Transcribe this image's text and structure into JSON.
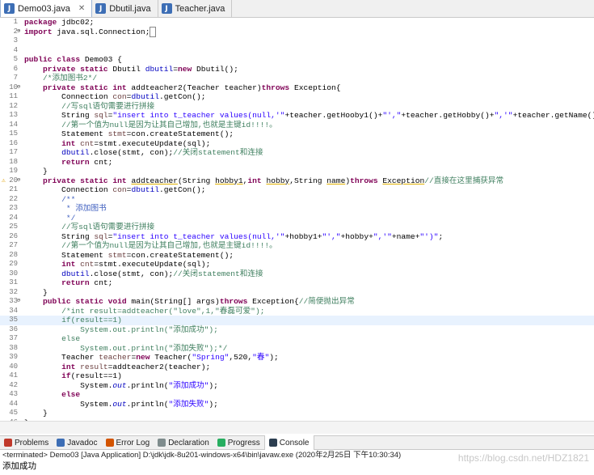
{
  "tabs": [
    {
      "label": "Demo03.java",
      "active": true,
      "icon": "java-file-icon"
    },
    {
      "label": "Dbutil.java",
      "active": false,
      "icon": "java-file-icon"
    },
    {
      "label": "Teacher.java",
      "active": false,
      "icon": "java-file-icon"
    }
  ],
  "editor": {
    "lines": [
      {
        "n": "1",
        "fold": "",
        "marker": "",
        "html": "<span class='kw'>package</span> jdbc02;"
      },
      {
        "n": "2",
        "fold": "⊕",
        "marker": "",
        "html": "<span class='kw'>import</span> java.sql.Connection;<span style='border:1px solid #888'>&nbsp;</span>"
      },
      {
        "n": "3",
        "fold": "",
        "marker": "",
        "html": ""
      },
      {
        "n": "4",
        "fold": "",
        "marker": "",
        "html": ""
      },
      {
        "n": "5",
        "fold": "",
        "marker": "",
        "html": "<span class='kw'>public class</span> Demo03 {"
      },
      {
        "n": "6",
        "fold": "",
        "marker": "",
        "html": "    <span class='kw'>private static</span> Dbutil <span class='fd'>dbutil</span>=<span class='kw'>new</span> Dbutil();"
      },
      {
        "n": "7",
        "fold": "",
        "marker": "",
        "html": "    <span class='cm'>/*添加图书2*/</span>"
      },
      {
        "n": "10",
        "fold": "⊖",
        "marker": "",
        "html": "    <span class='kw'>private static int</span> addteacher2(Teacher teacher)<span class='kw'>throws</span> Exception{"
      },
      {
        "n": "11",
        "fold": "",
        "marker": "",
        "html": "        Connection <span style='color:#6a3e3e'>con</span>=<span class='fd'>dbutil</span>.getCon();"
      },
      {
        "n": "12",
        "fold": "",
        "marker": "",
        "html": "        <span class='cm'>//写sql语句需要进行拼接</span>"
      },
      {
        "n": "13",
        "fold": "",
        "marker": "",
        "html": "        String <span style='color:#6a3e3e'>sql</span>=<span class='st'>\"insert into t_teacher values(null,'\"</span>+teacher.getHooby1()+<span class='st'>\"',\"</span>+teacher.getHobby()+<span class='st'>\",'\"</span>+teacher.getName()+<span class='st'>\"')\"</span>;"
      },
      {
        "n": "14",
        "fold": "",
        "marker": "",
        "html": "        <span class='cm'>//第一个值为null是因为让其自己增加,也就是主键id!!!!。</span>"
      },
      {
        "n": "15",
        "fold": "",
        "marker": "",
        "html": "        Statement <span style='color:#6a3e3e'>stmt</span>=con.createStatement();"
      },
      {
        "n": "16",
        "fold": "",
        "marker": "",
        "html": "        <span class='kw'>int</span> <span style='color:#6a3e3e'>cnt</span>=stmt.executeUpdate(sql);"
      },
      {
        "n": "17",
        "fold": "",
        "marker": "",
        "html": "        <span class='fd'>dbutil</span>.close(stmt, con);<span class='cm'>//关闭statement和连接</span>"
      },
      {
        "n": "18",
        "fold": "",
        "marker": "",
        "html": "        <span class='kw'>return</span> cnt;"
      },
      {
        "n": "19",
        "fold": "",
        "marker": "",
        "html": "    }"
      },
      {
        "n": "20",
        "fold": "⊖",
        "marker": "⚠",
        "html": "    <span class='kw'>private static int</span> <span class='u'>addteacher</span>(String <span class='u'>hobby1</span>,<span class='kw'>int</span> <span class='u'>hobby</span>,String <span class='u'>name</span>)<span class='kw'>throws</span> <span class='u'>Exception</span><span class='cm'>//直接在这里捕获异常</span>"
      },
      {
        "n": "21",
        "fold": "",
        "marker": "",
        "html": "        Connection <span style='color:#6a3e3e'>con</span>=<span class='fd'>dbutil</span>.getCon();"
      },
      {
        "n": "22",
        "fold": "",
        "marker": "",
        "html": "        <span class='dc'>/**</span>"
      },
      {
        "n": "23",
        "fold": "",
        "marker": "",
        "html": "         <span class='dc'>* 添加图书</span>"
      },
      {
        "n": "24",
        "fold": "",
        "marker": "",
        "html": "         <span class='dc'>*/</span>"
      },
      {
        "n": "25",
        "fold": "",
        "marker": "",
        "html": "        <span class='cm'>//写sql语句需要进行拼接</span>"
      },
      {
        "n": "26",
        "fold": "",
        "marker": "",
        "html": "        String <span style='color:#6a3e3e'>sql</span>=<span class='st'>\"insert into t_teacher values(null,'\"</span>+hobby1+<span class='st'>\"',\"</span>+hobby+<span class='st'>\",'\"</span>+name+<span class='st'>\"')\"</span>;"
      },
      {
        "n": "27",
        "fold": "",
        "marker": "",
        "html": "        <span class='cm'>//第一个值为null是因为让其自己增加,也就是主键id!!!!。</span>"
      },
      {
        "n": "28",
        "fold": "",
        "marker": "",
        "html": "        Statement <span style='color:#6a3e3e'>stmt</span>=con.createStatement();"
      },
      {
        "n": "29",
        "fold": "",
        "marker": "",
        "html": "        <span class='kw'>int</span> <span style='color:#6a3e3e'>cnt</span>=stmt.executeUpdate(sql);"
      },
      {
        "n": "30",
        "fold": "",
        "marker": "",
        "html": "        <span class='fd'>dbutil</span>.close(stmt, con);<span class='cm'>//关闭statement和连接</span>"
      },
      {
        "n": "31",
        "fold": "",
        "marker": "",
        "html": "        <span class='kw'>return</span> cnt;"
      },
      {
        "n": "32",
        "fold": "",
        "marker": "",
        "html": "    }"
      },
      {
        "n": "33",
        "fold": "⊖",
        "marker": "",
        "html": "    <span class='kw'>public static void</span> main(String[] args)<span class='kw'>throws</span> Exception{<span class='cm'>//简便抛出异常</span>"
      },
      {
        "n": "34",
        "fold": "",
        "marker": "",
        "html": "        <span class='cm'>/*int result=addteacher(\"love\",1,\"春磊可爱\");</span>"
      },
      {
        "n": "35",
        "fold": "",
        "marker": "",
        "hl": true,
        "html": "        <span class='cm'>if(result==1)</span>"
      },
      {
        "n": "36",
        "fold": "",
        "marker": "",
        "html": "            <span class='cm'>System.out.println(\"添加成功\");</span>"
      },
      {
        "n": "37",
        "fold": "",
        "marker": "",
        "html": "        <span class='cm'>else</span>"
      },
      {
        "n": "38",
        "fold": "",
        "marker": "",
        "html": "            <span class='cm'>System.out.println(\"添加失败\");*/</span>"
      },
      {
        "n": "39",
        "fold": "",
        "marker": "",
        "html": "        Teacher <span style='color:#6a3e3e'>teacher</span>=<span class='kw'>new</span> Teacher(<span class='st'>\"Spring\"</span>,520,<span class='st'>\"春\"</span>);"
      },
      {
        "n": "40",
        "fold": "",
        "marker": "",
        "html": "        <span class='kw'>int</span> <span style='color:#6a3e3e'>result</span>=addteacher2(teacher);"
      },
      {
        "n": "41",
        "fold": "",
        "marker": "",
        "html": "        <span class='kw'>if</span>(result==1)"
      },
      {
        "n": "42",
        "fold": "",
        "marker": "",
        "html": "            System.<span class='fd'><i>out</i></span>.println(<span class='st'>\"添加成功\"</span>);"
      },
      {
        "n": "43",
        "fold": "",
        "marker": "",
        "html": "        <span class='kw'>else</span>"
      },
      {
        "n": "44",
        "fold": "",
        "marker": "",
        "html": "            System.<span class='fd'><i>out</i></span>.println(<span class='st'>\"添加失败\"</span>);"
      },
      {
        "n": "45",
        "fold": "",
        "marker": "",
        "html": "    }"
      },
      {
        "n": "46",
        "fold": "",
        "marker": "",
        "html": "}"
      }
    ]
  },
  "views": [
    {
      "label": "Problems",
      "icon": "problems-icon",
      "color": "#c0392b",
      "active": false
    },
    {
      "label": "Javadoc",
      "icon": "javadoc-icon",
      "color": "#3d6eb5",
      "active": false
    },
    {
      "label": "Error Log",
      "icon": "error-log-icon",
      "color": "#d35400",
      "active": false
    },
    {
      "label": "Declaration",
      "icon": "declaration-icon",
      "color": "#7f8c8d",
      "active": false
    },
    {
      "label": "Progress",
      "icon": "progress-icon",
      "color": "#27ae60",
      "active": false
    },
    {
      "label": "Console",
      "icon": "console-icon",
      "color": "#2c3e50",
      "active": true
    }
  ],
  "console": {
    "header": "<terminated> Demo03 [Java Application] D:\\jdk\\jdk-8u201-windows-x64\\bin\\javaw.exe (2020年2月25日 下午10:30:34)",
    "output": "添加成功",
    "watermark": "https://blog.csdn.net/HDZ1821"
  }
}
